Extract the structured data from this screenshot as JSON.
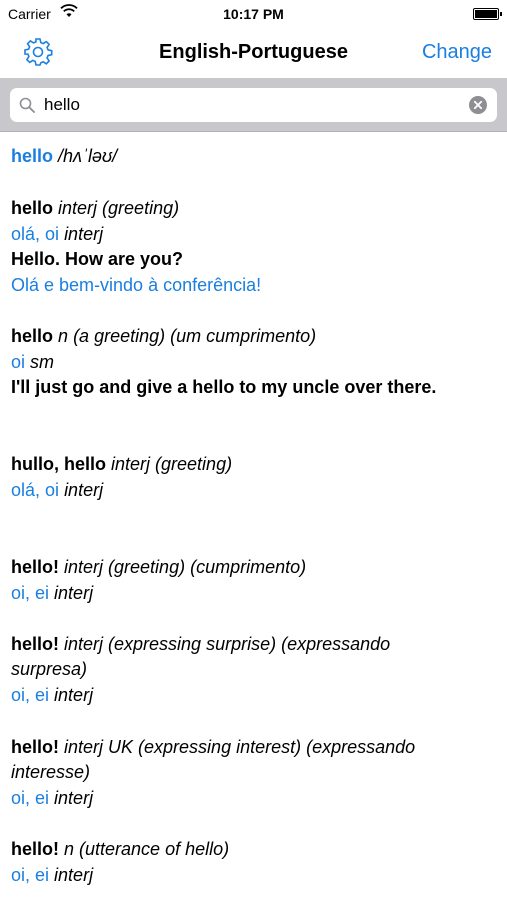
{
  "status": {
    "carrier": "Carrier",
    "time": "10:17 PM"
  },
  "nav": {
    "title": "English-Portuguese",
    "change_label": "Change"
  },
  "search": {
    "query": "hello"
  },
  "entry": {
    "headword": "hello",
    "pronunciation": "/hʌˈləʊ/",
    "blocks": [
      {
        "word": "hello",
        "desc": "interj (greeting)"
      },
      {
        "trans": "olá, oi",
        "trans_pos": "interj"
      },
      {
        "example": "Hello. How are you?"
      },
      {
        "example_trans": "Olá e bem-vindo à conferência!"
      },
      {
        "word": "hello",
        "pos": "n",
        "desc": "(a greeting) (um cumprimento)"
      },
      {
        "trans": "oi",
        "trans_pos": "sm"
      },
      {
        "example": "I'll just go and give a hello to my uncle over there."
      },
      {
        "word": "hullo, hello",
        "desc": "interj (greeting)"
      },
      {
        "trans": "olá, oi",
        "trans_pos": "interj"
      },
      {
        "word": "hello!",
        "desc": "interj (greeting) (cumprimento)"
      },
      {
        "trans": "oi, ei",
        "trans_pos": "interj"
      },
      {
        "word": "hello!",
        "desc": "interj (expressing surprise) (expressando",
        "desc2": "surpresa)"
      },
      {
        "trans": "oi, ei",
        "trans_pos": "interj"
      },
      {
        "word": "hello!",
        "desc": "interj UK (expressing interest) (expressando",
        "desc2": "interesse)"
      },
      {
        "trans": "oi, ei",
        "trans_pos": "interj"
      },
      {
        "word": "hello!",
        "desc": "n (utterance of hello)"
      },
      {
        "trans": "oi, ei",
        "trans_pos": "interj"
      }
    ]
  },
  "colors": {
    "accent": "#1a7fe0",
    "searchbar_bg": "#c8c7cc"
  }
}
